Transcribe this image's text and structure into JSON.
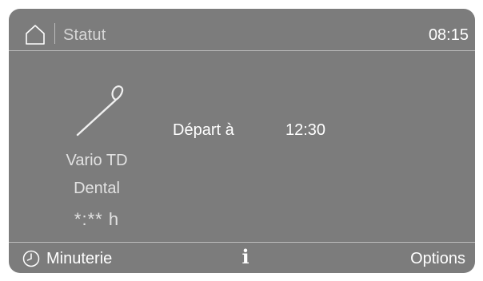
{
  "header": {
    "title": "Statut",
    "clock": "08:15",
    "home_icon": "home-icon"
  },
  "program": {
    "icon": "dental-instrument-icon",
    "name_line1": "Vario TD",
    "name_line2": "Dental",
    "duration": "*:** h"
  },
  "start": {
    "label": "Départ à",
    "time": "12:30"
  },
  "footer": {
    "timer_icon": "clock-icon",
    "timer_label": "Minuterie",
    "info_label": "i",
    "options_label": "Options"
  },
  "colors": {
    "screen_background": "#7c7c7c",
    "text": "#ffffff",
    "divider": "#bdbdbd"
  }
}
